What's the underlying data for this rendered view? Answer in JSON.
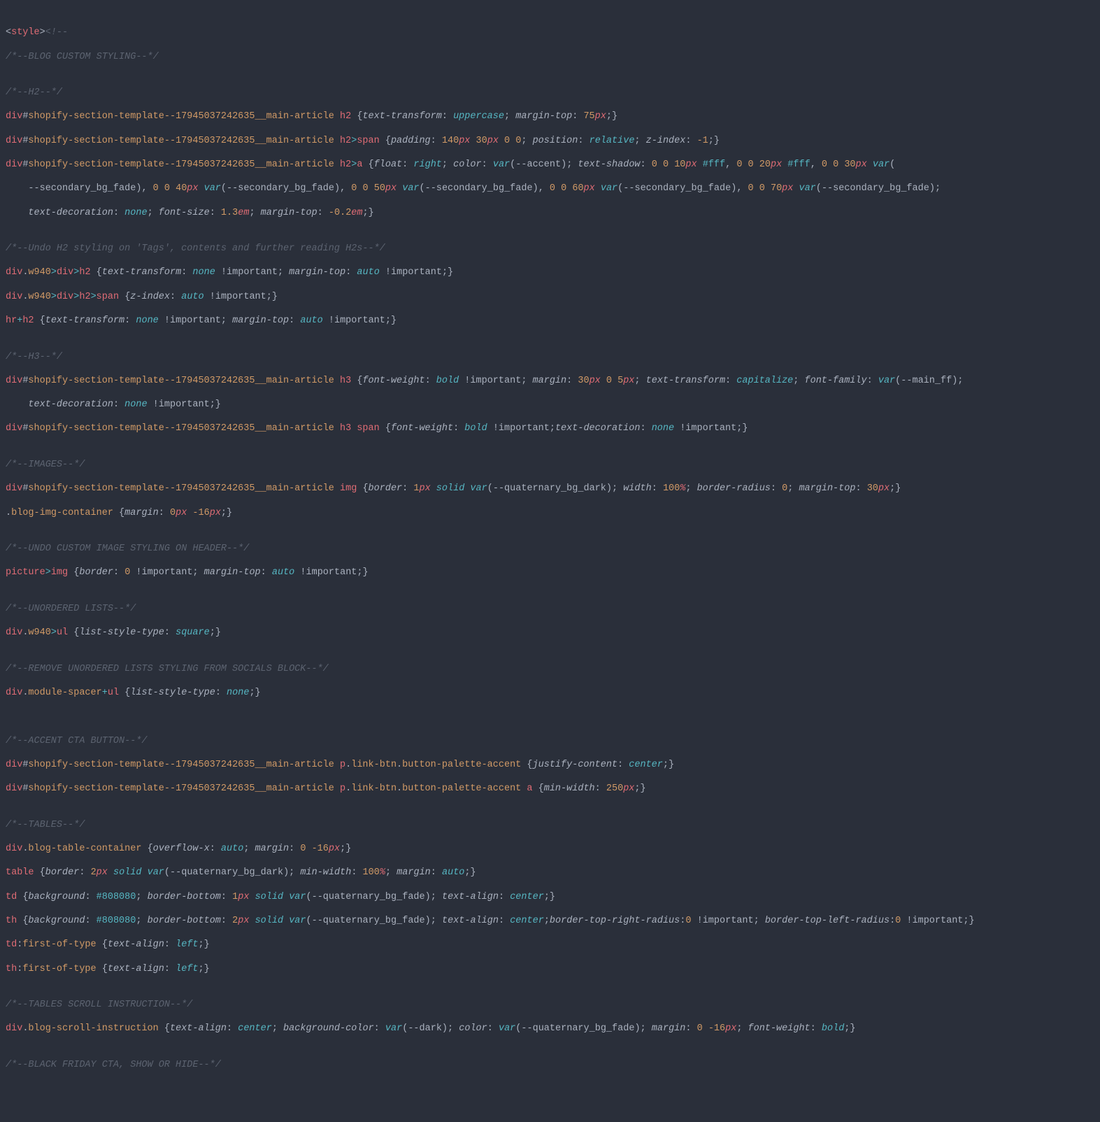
{
  "code": {
    "l1_open": "<",
    "l1_style": "style",
    "l1_close": ">",
    "l1_cstart": "<!--",
    "c_blog": "/*--BLOG CUSTOM STYLING--*/",
    "c_h2": "/*--H2--*/",
    "sel_div": "div",
    "hash": "#",
    "id_main": "shopify-section-template--17945037242635__main-article",
    "h2": "h2",
    "h3": "h3",
    "span": "span",
    "a": "a",
    "img": "img",
    "p": "p",
    "ul": "ul",
    "hr": "hr",
    "td": "td",
    "th": "th",
    "table": "table",
    "picture": "picture",
    "gt": ">",
    "plus": "+",
    "dot": ".",
    "colon_p": ":",
    "lbrace": "{",
    "rbrace": "}",
    "semi": ";",
    "colon": ":",
    "space": " ",
    "comma": ", ",
    "lparen": "(",
    "rparen": ")",
    "bang": "!important",
    "prop_texttransform": "text-transform",
    "prop_margintop": "margin-top",
    "prop_padding": "padding",
    "prop_position": "position",
    "prop_zindex": "z-index",
    "prop_float": "float",
    "prop_color": "color",
    "prop_textshadow": "text-shadow",
    "prop_textdecoration": "text-decoration",
    "prop_fontsize": "font-size",
    "prop_fontweight": "font-weight",
    "prop_margin": "margin",
    "prop_fontfamily": "font-family",
    "prop_border": "border",
    "prop_width": "width",
    "prop_borderradius": "border-radius",
    "prop_liststyle": "list-style-type",
    "prop_justify": "justify-content",
    "prop_minwidth": "min-width",
    "prop_overflowx": "overflow-x",
    "prop_background": "background",
    "prop_borderbottom": "border-bottom",
    "prop_textalign": "text-align",
    "prop_btrr": "border-top-right-radius",
    "prop_btlr": "border-top-left-radius",
    "prop_bgcolor": "background-color",
    "kw_uppercase": "uppercase",
    "kw_relative": "relative",
    "kw_right": "right",
    "kw_none": "none",
    "kw_auto": "auto",
    "kw_bold": "bold",
    "kw_capitalize": "capitalize",
    "kw_solid": "solid",
    "kw_square": "square",
    "kw_center": "center",
    "kw_left": "left",
    "kw_var": "var",
    "n_75": "75",
    "n_140": "140",
    "n_30": "30",
    "n_0": "0",
    "n_neg1": "-1",
    "n_10": "10",
    "n_20": "20",
    "n_40": "40",
    "n_50": "50",
    "n_60": "60",
    "n_70": "70",
    "n_1p3": "1.3",
    "n_neg0p2": "-0.2",
    "n_5": "5",
    "n_1": "1",
    "n_100": "100",
    "n_neg16": "-16",
    "n_250": "250",
    "n_2": "2",
    "u_px": "px",
    "u_em": "em",
    "u_pct": "%",
    "hex_fff": "#fff",
    "hex_808080": "#808080",
    "v_accent": "--accent",
    "v_sbg": "--secondary_bg_fade",
    "v_qbd": "--quaternary_bg_dark",
    "v_qbf": "--quaternary_bg_fade",
    "v_mainff": "--main_ff",
    "v_dark": "--dark",
    "cls_w940": "w940",
    "cls_blogimg": "blog-img-container",
    "cls_modspacer": "module-spacer",
    "cls_linkbtn": "link-btn",
    "cls_btnpal": "button-palette-accent",
    "cls_blogtable": "blog-table-container",
    "cls_blogscroll": "blog-scroll-instruction",
    "ps_firstoftype": "first-of-type",
    "c_undoh2": "/*--Undo H2 styling on 'Tags', contents and further reading H2s--*/",
    "c_h3": "/*--H3--*/",
    "c_images": "/*--IMAGES--*/",
    "c_undoimg": "/*--UNDO CUSTOM IMAGE STYLING ON HEADER--*/",
    "c_ul": "/*--UNORDERED LISTS--*/",
    "c_remul": "/*--REMOVE UNORDERED LISTS STYLING FROM SOCIALS BLOCK--*/",
    "c_cta": "/*--ACCENT CTA BUTTON--*/",
    "c_tables": "/*--TABLES--*/",
    "c_tscroll": "/*--TABLES SCROLL INSTRUCTION--*/",
    "c_bf": "/*--BLACK FRIDAY CTA, SHOW OR HIDE--*/"
  }
}
